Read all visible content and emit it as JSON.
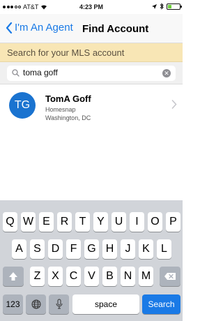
{
  "status_bar": {
    "carrier": "AT&T",
    "time": "4:23 PM"
  },
  "nav": {
    "back_label": "I'm An Agent",
    "title": "Find Account"
  },
  "banner": {
    "text": "Search for your MLS account"
  },
  "search": {
    "value": "toma goff"
  },
  "results": [
    {
      "initials": "TG",
      "name": "TomA Goff",
      "company": "Homesnap",
      "location": "Washington, DC"
    }
  ],
  "keyboard": {
    "row1": [
      "Q",
      "W",
      "E",
      "R",
      "T",
      "Y",
      "U",
      "I",
      "O",
      "P"
    ],
    "row2": [
      "A",
      "S",
      "D",
      "F",
      "G",
      "H",
      "J",
      "K",
      "L"
    ],
    "row3": [
      "Z",
      "X",
      "C",
      "V",
      "B",
      "N",
      "M"
    ],
    "numbers_label": "123",
    "space_label": "space",
    "search_label": "Search"
  },
  "colors": {
    "accent": "#1a7ae6",
    "banner": "#f8e6b5",
    "avatar": "#1a73d0"
  }
}
